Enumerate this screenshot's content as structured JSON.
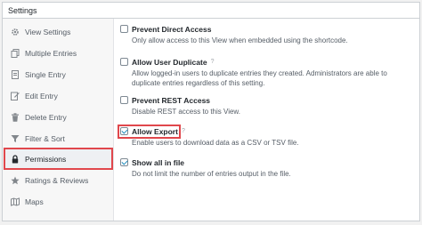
{
  "panel": {
    "title": "Settings"
  },
  "sidebar": {
    "items": [
      {
        "label": "View Settings",
        "icon": "gear-icon"
      },
      {
        "label": "Multiple Entries",
        "icon": "multiple-entries-icon"
      },
      {
        "label": "Single Entry",
        "icon": "single-entry-icon"
      },
      {
        "label": "Edit Entry",
        "icon": "edit-icon"
      },
      {
        "label": "Delete Entry",
        "icon": "trash-icon"
      },
      {
        "label": "Filter & Sort",
        "icon": "filter-icon"
      },
      {
        "label": "Permissions",
        "icon": "lock-icon",
        "active": true
      },
      {
        "label": "Ratings & Reviews",
        "icon": "star-icon"
      },
      {
        "label": "Maps",
        "icon": "map-icon"
      }
    ]
  },
  "settings": [
    {
      "label": "Prevent Direct Access",
      "checked": false,
      "help": false,
      "description": "Only allow access to this View when embedded using the shortcode."
    },
    {
      "label": "Allow User Duplicate",
      "checked": false,
      "help": true,
      "description": "Allow logged-in users to duplicate entries they created. Administrators are able to duplicate entries regardless of this setting."
    },
    {
      "label": "Prevent REST Access",
      "checked": false,
      "help": false,
      "description": "Disable REST access to this View."
    },
    {
      "label": "Allow Export",
      "checked": true,
      "help": true,
      "highlighted": true,
      "description": "Enable users to download data as a CSV or TSV file."
    },
    {
      "label": "Show all in file",
      "checked": true,
      "help": false,
      "description": "Do not limit the number of entries output in the file."
    }
  ],
  "help_glyph": "?",
  "colors": {
    "highlight": "#e0474c",
    "check": "#1e8cbe"
  }
}
